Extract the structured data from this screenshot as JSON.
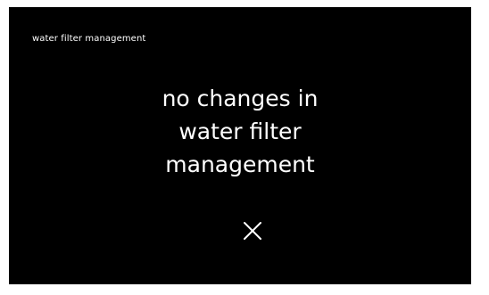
{
  "header": {
    "title": "water filter management"
  },
  "message": {
    "lines": [
      "no changes in",
      "water filter",
      "management"
    ]
  },
  "close_button": {
    "icon": "close-icon",
    "color": "#ffffff"
  },
  "colors": {
    "background": "#000000",
    "text": "#ffffff"
  }
}
